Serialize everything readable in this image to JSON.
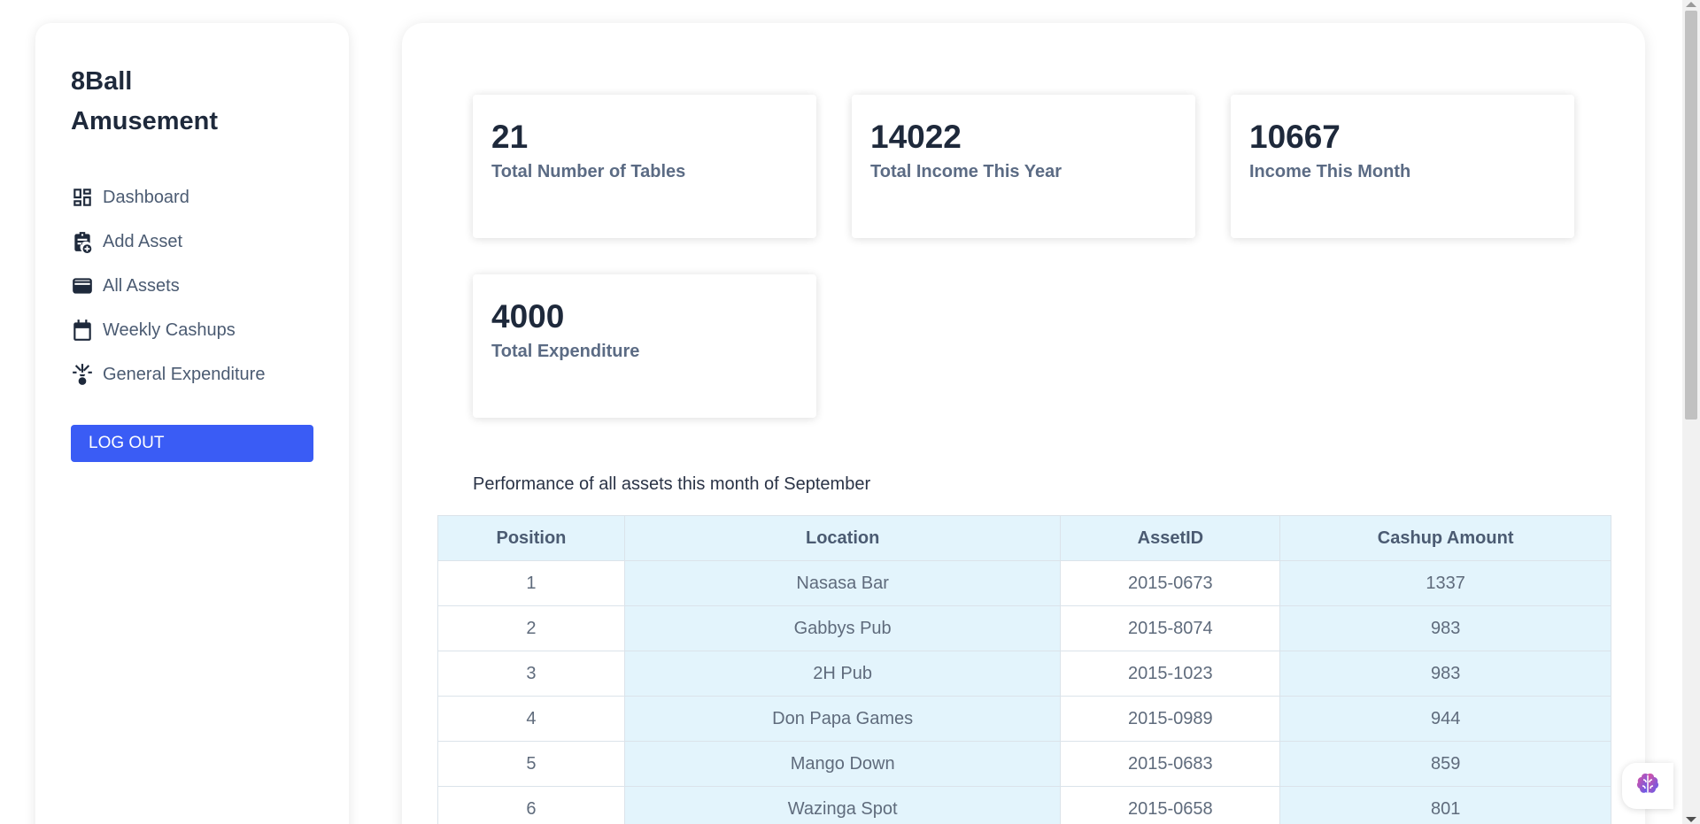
{
  "brand": {
    "name": "8Ball Amusement"
  },
  "sidebar": {
    "items": [
      {
        "label": "Dashboard",
        "icon": "dashboard-icon"
      },
      {
        "label": "Add Asset",
        "icon": "clipboard-add-icon"
      },
      {
        "label": "All Assets",
        "icon": "wallet-icon"
      },
      {
        "label": "Weekly Cashups",
        "icon": "calendar-icon"
      },
      {
        "label": "General Expenditure",
        "icon": "expenditure-icon"
      }
    ],
    "logout_label": "LOG OUT"
  },
  "stats": [
    {
      "value": "21",
      "label": "Total Number of Tables"
    },
    {
      "value": "14022",
      "label": "Total Income This Year"
    },
    {
      "value": "10667",
      "label": "Income This Month"
    },
    {
      "value": "4000",
      "label": "Total Expenditure"
    }
  ],
  "performance": {
    "title": "Performance of all assets this month of September",
    "columns": [
      "Position",
      "Location",
      "AssetID",
      "Cashup Amount"
    ],
    "rows": [
      [
        "1",
        "Nasasa Bar",
        "2015-0673",
        "1337"
      ],
      [
        "2",
        "Gabbys Pub",
        "2015-8074",
        "983"
      ],
      [
        "3",
        "2H Pub",
        "2015-1023",
        "983"
      ],
      [
        "4",
        "Don Papa Games",
        "2015-0989",
        "944"
      ],
      [
        "5",
        "Mango Down",
        "2015-0683",
        "859"
      ],
      [
        "6",
        "Wazinga Spot",
        "2015-0658",
        "801"
      ]
    ]
  },
  "colors": {
    "accent": "#3a5cf5",
    "table_tint": "#e3f4fc",
    "text_dark": "#1e293b",
    "text_muted": "#5b6b84"
  }
}
